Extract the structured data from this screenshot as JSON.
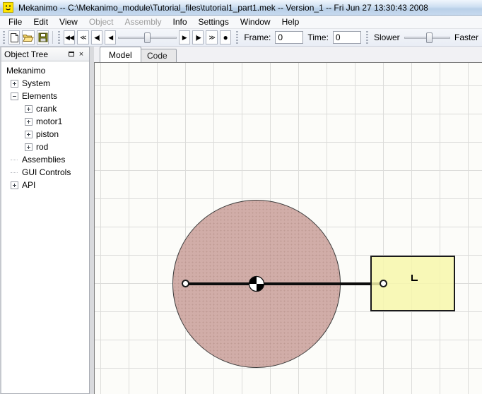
{
  "window": {
    "title": "Mekanimo   --   C:\\Mekanimo_module\\Tutorial_files\\tutorial1_part1.mek   --   Version_1   --   Fri Jun 27 13:30:43 2008",
    "icon": "mekanimo-smiley-icon"
  },
  "menu": {
    "items": [
      {
        "label": "File",
        "enabled": true
      },
      {
        "label": "Edit",
        "enabled": true
      },
      {
        "label": "View",
        "enabled": true
      },
      {
        "label": "Object",
        "enabled": false
      },
      {
        "label": "Assembly",
        "enabled": false
      },
      {
        "label": "Info",
        "enabled": true
      },
      {
        "label": "Settings",
        "enabled": true
      },
      {
        "label": "Window",
        "enabled": true
      },
      {
        "label": "Help",
        "enabled": true
      }
    ]
  },
  "toolbar": {
    "file_icons": [
      "new-file-icon",
      "open-folder-icon",
      "save-floppy-icon"
    ],
    "playback": {
      "fast_rewind": "◀◀",
      "skip_back": "≪",
      "step_back": "◀|",
      "play_back": "◀",
      "play": "▶",
      "step_forward": "|▶",
      "skip_forward": "≫",
      "record": "●"
    },
    "frame_label": "Frame:",
    "frame_value": "0",
    "time_label": "Time:",
    "time_value": "0",
    "slower_label": "Slower",
    "faster_label": "Faster",
    "frame_slider_pos_pct": 44,
    "speed_slider_pos_pct": 48
  },
  "dock": {
    "title": "Object Tree",
    "buttons": {
      "float": "float-window-icon",
      "close": "×"
    }
  },
  "tree": {
    "items": [
      {
        "label": "Mekanimo",
        "depth": 0,
        "expander": "none"
      },
      {
        "label": "System",
        "depth": 1,
        "expander": "plus"
      },
      {
        "label": "Elements",
        "depth": 1,
        "expander": "minus"
      },
      {
        "label": "crank",
        "depth": 2,
        "expander": "plus"
      },
      {
        "label": "motor1",
        "depth": 2,
        "expander": "plus"
      },
      {
        "label": "piston",
        "depth": 2,
        "expander": "plus"
      },
      {
        "label": "rod",
        "depth": 2,
        "expander": "plus"
      },
      {
        "label": "Assemblies",
        "depth": 1,
        "expander": "none"
      },
      {
        "label": "GUI Controls",
        "depth": 1,
        "expander": "none"
      },
      {
        "label": "API",
        "depth": 1,
        "expander": "plus"
      }
    ]
  },
  "tabs": [
    {
      "label": "Model",
      "active": true
    },
    {
      "label": "Code",
      "active": false
    }
  ],
  "canvas": {
    "grid_spacing_px": 40,
    "elements": {
      "crank": {
        "shape": "circle",
        "fill": "#cba29c"
      },
      "rod": {
        "shape": "line",
        "color": "#0d0d0d"
      },
      "piston": {
        "shape": "rect",
        "fill": "#f7f7ac",
        "marker": "L"
      },
      "center_of_mass_marker": {
        "colors": [
          "#000000",
          "#ffffff"
        ]
      },
      "joints": 2
    }
  },
  "colors": {
    "titlebar": "#c6d9ee",
    "toolbar": "#eef1f7",
    "canvas_bg": "#fcfcf9",
    "grid_line": "#dcdcda",
    "crank_fill": "#cba29c",
    "piston_fill": "#f7f7ac"
  }
}
